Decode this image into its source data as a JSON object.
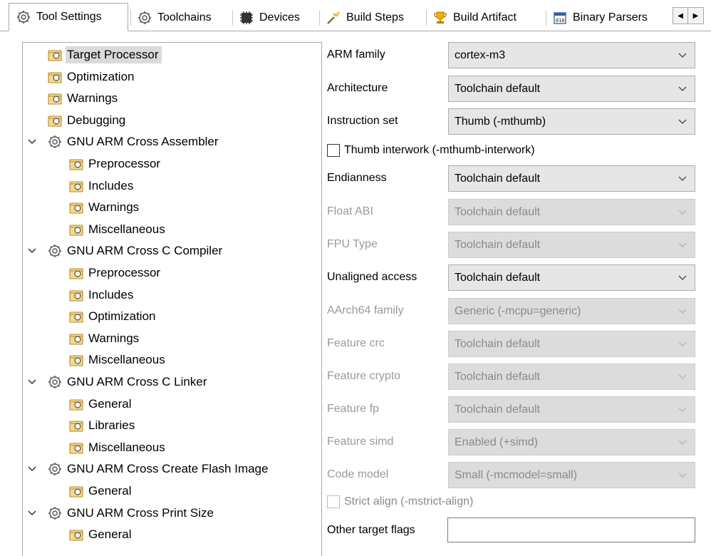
{
  "tabs": [
    {
      "label": "Tool Settings",
      "icon": "gear-icon",
      "active": true
    },
    {
      "label": "Toolchains",
      "icon": "gear-icon",
      "active": false
    },
    {
      "label": "Devices",
      "icon": "chip-icon",
      "active": false
    },
    {
      "label": "Build Steps",
      "icon": "build-steps-icon",
      "active": false
    },
    {
      "label": "Build Artifact",
      "icon": "trophy-icon",
      "active": false
    },
    {
      "label": "Binary Parsers",
      "icon": "binary-icon",
      "active": false
    }
  ],
  "tree": [
    {
      "label": "Target Processor",
      "level": 1,
      "selected": true,
      "expandable": false
    },
    {
      "label": "Optimization",
      "level": 1,
      "expandable": false
    },
    {
      "label": "Warnings",
      "level": 1,
      "expandable": false
    },
    {
      "label": "Debugging",
      "level": 1,
      "expandable": false
    },
    {
      "label": "GNU ARM Cross Assembler",
      "level": 0,
      "expandable": true
    },
    {
      "label": "Preprocessor",
      "level": 2,
      "expandable": false
    },
    {
      "label": "Includes",
      "level": 2,
      "expandable": false
    },
    {
      "label": "Warnings",
      "level": 2,
      "expandable": false
    },
    {
      "label": "Miscellaneous",
      "level": 2,
      "expandable": false
    },
    {
      "label": "GNU ARM Cross C Compiler",
      "level": 0,
      "expandable": true
    },
    {
      "label": "Preprocessor",
      "level": 2,
      "expandable": false
    },
    {
      "label": "Includes",
      "level": 2,
      "expandable": false
    },
    {
      "label": "Optimization",
      "level": 2,
      "expandable": false
    },
    {
      "label": "Warnings",
      "level": 2,
      "expandable": false
    },
    {
      "label": "Miscellaneous",
      "level": 2,
      "expandable": false
    },
    {
      "label": "GNU ARM Cross C Linker",
      "level": 0,
      "expandable": true
    },
    {
      "label": "General",
      "level": 2,
      "expandable": false
    },
    {
      "label": "Libraries",
      "level": 2,
      "expandable": false
    },
    {
      "label": "Miscellaneous",
      "level": 2,
      "expandable": false
    },
    {
      "label": "GNU ARM Cross Create Flash Image",
      "level": 0,
      "expandable": true
    },
    {
      "label": "General",
      "level": 2,
      "expandable": false
    },
    {
      "label": "GNU ARM Cross Print Size",
      "level": 0,
      "expandable": true
    },
    {
      "label": "General",
      "level": 2,
      "expandable": false
    }
  ],
  "settings": {
    "arm_family": {
      "label": "ARM family",
      "value": "cortex-m3"
    },
    "architecture": {
      "label": "Architecture",
      "value": "Toolchain default"
    },
    "instruction_set": {
      "label": "Instruction set",
      "value": "Thumb (-mthumb)"
    },
    "thumb_interwork": {
      "label": "Thumb interwork (-mthumb-interwork)",
      "checked": false
    },
    "endianness": {
      "label": "Endianness",
      "value": "Toolchain default"
    },
    "float_abi": {
      "label": "Float ABI",
      "value": "Toolchain default",
      "disabled": true
    },
    "fpu_type": {
      "label": "FPU Type",
      "value": "Toolchain default",
      "disabled": true
    },
    "unaligned_access": {
      "label": "Unaligned access",
      "value": "Toolchain default"
    },
    "aarch64_family": {
      "label": "AArch64 family",
      "value": "Generic (-mcpu=generic)",
      "disabled": true
    },
    "feature_crc": {
      "label": "Feature crc",
      "value": "Toolchain default",
      "disabled": true
    },
    "feature_crypto": {
      "label": "Feature crypto",
      "value": "Toolchain default",
      "disabled": true
    },
    "feature_fp": {
      "label": "Feature fp",
      "value": "Toolchain default",
      "disabled": true
    },
    "feature_simd": {
      "label": "Feature simd",
      "value": "Enabled (+simd)",
      "disabled": true
    },
    "code_model": {
      "label": "Code model",
      "value": "Small (-mcmodel=small)",
      "disabled": true
    },
    "strict_align": {
      "label": "Strict align (-mstrict-align)",
      "checked": false,
      "disabled": true
    },
    "other_target_flags": {
      "label": "Other target flags",
      "value": ""
    }
  },
  "scroll": {
    "left_arrow": "◀",
    "right_arrow": "▶"
  },
  "colors": {
    "selection": "#dadada",
    "combo_bg": "#e6e6e6",
    "disabled_text": "#9a9a9a",
    "border": "#a9a9a9"
  }
}
